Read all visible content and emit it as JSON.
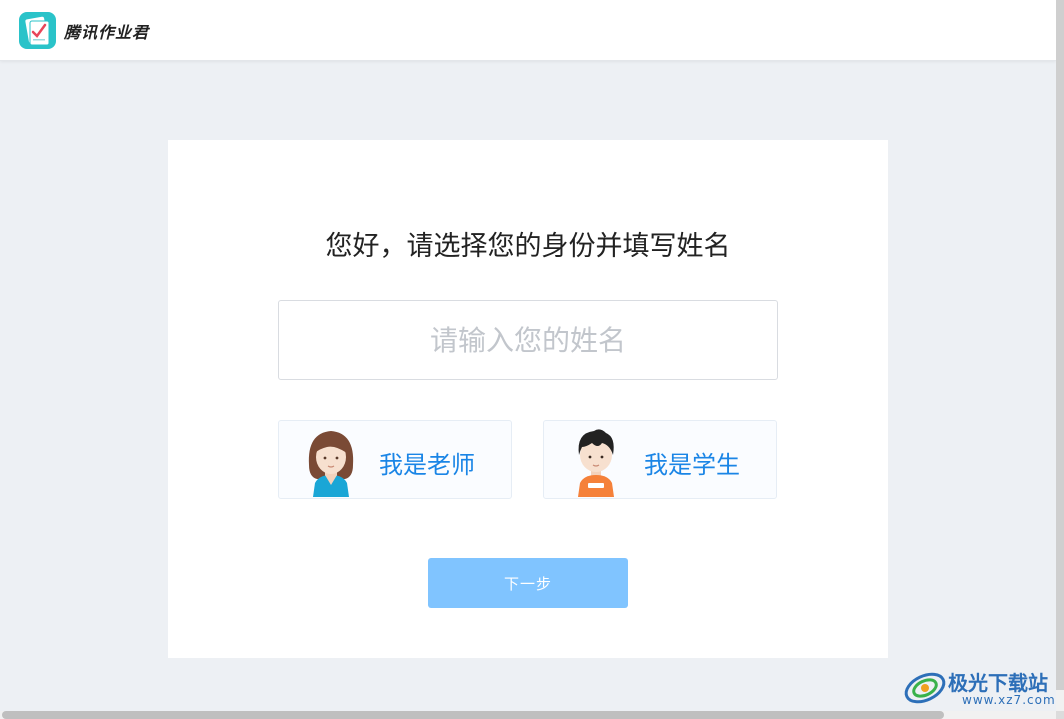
{
  "app": {
    "brand": "腾讯作业君"
  },
  "form": {
    "title": "您好，请选择您的身份并填写姓名",
    "name_value": "",
    "name_placeholder": "请输入您的姓名",
    "roles": [
      {
        "label": "我是老师"
      },
      {
        "label": "我是学生"
      }
    ],
    "next_label": "下一步"
  },
  "watermark": {
    "text": "极光下载站",
    "url": "www.xz7.com"
  },
  "colors": {
    "background": "#edf0f4",
    "accent_text": "#1a85e6",
    "button": "#80c4ff",
    "teacher_shirt": "#1aa6d6",
    "student_shirt": "#f5813a"
  },
  "icons": [
    "app-logo-icon",
    "teacher-avatar-icon",
    "student-avatar-icon",
    "watermark-logo-icon"
  ]
}
